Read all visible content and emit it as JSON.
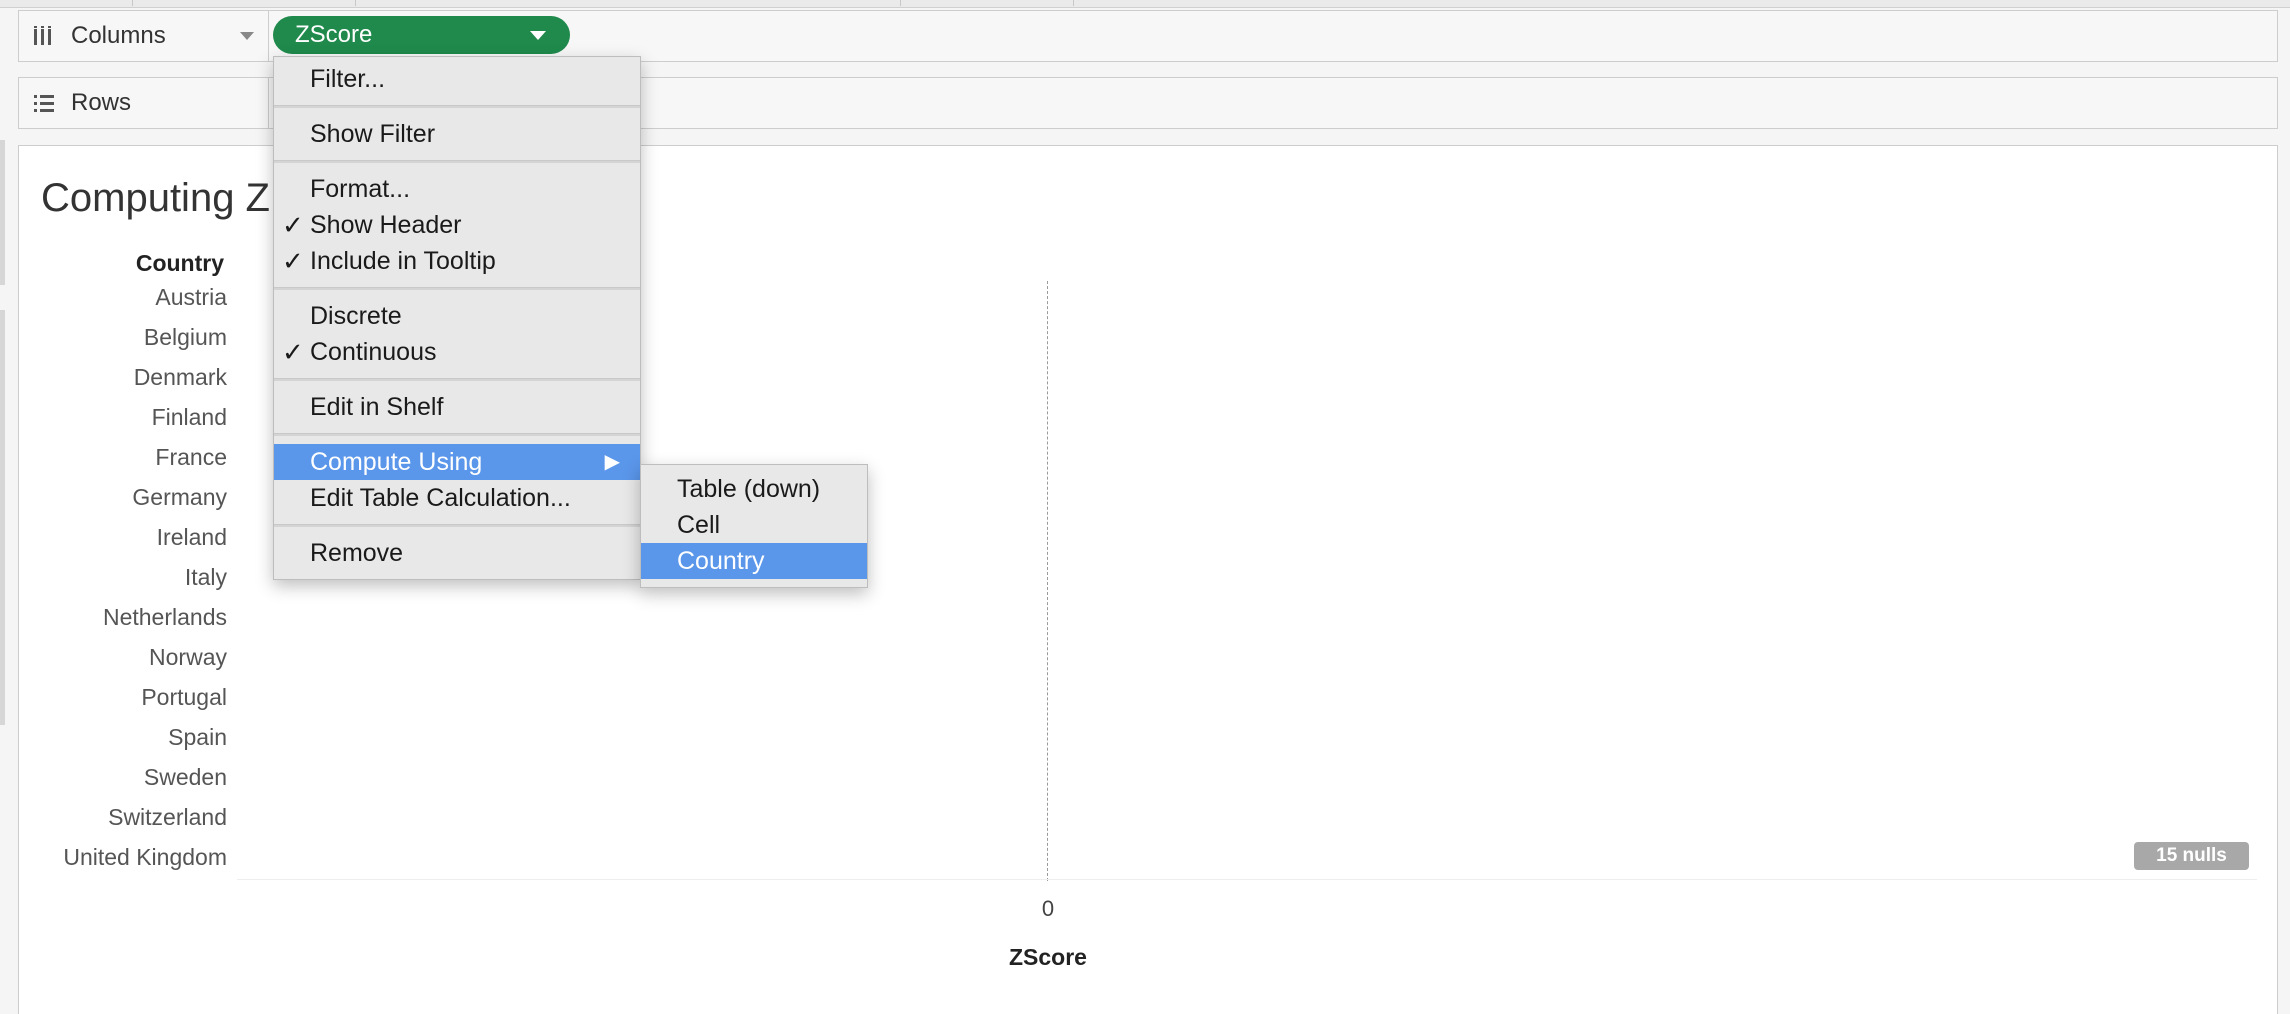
{
  "shelves": {
    "columns_label": "Columns",
    "rows_label": "Rows",
    "columns_pill": "ZScore"
  },
  "view": {
    "title": "Computing Z",
    "row_header": "Country",
    "countries": [
      "Austria",
      "Belgium",
      "Denmark",
      "Finland",
      "France",
      "Germany",
      "Ireland",
      "Italy",
      "Netherlands",
      "Norway",
      "Portugal",
      "Spain",
      "Sweden",
      "Switzerland",
      "United Kingdom"
    ],
    "axis_tick": "0",
    "axis_title": "ZScore",
    "null_badge": "15 nulls"
  },
  "context_menu": {
    "filter": "Filter...",
    "show_filter": "Show Filter",
    "format": "Format...",
    "show_header": "Show Header",
    "include_tooltip": "Include in Tooltip",
    "discrete": "Discrete",
    "continuous": "Continuous",
    "edit_in_shelf": "Edit in Shelf",
    "compute_using": "Compute Using",
    "edit_table_calc": "Edit Table Calculation...",
    "remove": "Remove",
    "check_glyph": "✓",
    "arrow_glyph": "▶"
  },
  "submenu": {
    "table_down": "Table (down)",
    "cell": "Cell",
    "country": "Country"
  },
  "colors": {
    "pill_green": "#1f8a4c",
    "highlight_blue": "#5a96ea",
    "null_badge_gray": "#a8a8a8"
  },
  "icons": {
    "columns": "columns-icon",
    "rows": "rows-icon",
    "dropdown": "caret-down-icon",
    "submenu": "chevron-right-icon",
    "check": "checkmark-icon"
  }
}
